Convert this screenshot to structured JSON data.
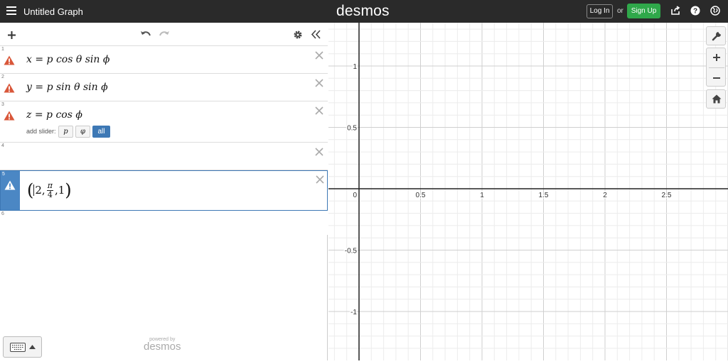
{
  "header": {
    "title": "Untitled Graph",
    "logo": "desmos",
    "login_label": "Log In",
    "or_text": "or",
    "signup_label": "Sign Up"
  },
  "toolbar": {
    "add_icon": "plus-icon",
    "undo_icon": "undo-icon",
    "redo_icon": "redo-icon",
    "settings_icon": "gear-icon",
    "collapse_icon": "double-chevron-left-icon"
  },
  "expressions": [
    {
      "number": "1",
      "var": "x",
      "rhs": "p cos θ sin ϕ",
      "warning": true
    },
    {
      "number": "2",
      "var": "y",
      "rhs": "p sin θ sin ϕ",
      "warning": true
    },
    {
      "number": "3",
      "var": "z",
      "rhs": "p cos ϕ",
      "warning": true,
      "slider": {
        "label": "add slider:",
        "options": [
          "p",
          "φ",
          "all"
        ]
      }
    },
    {
      "number": "4",
      "text": ""
    },
    {
      "number": "5",
      "point": {
        "a": "2",
        "b_num": "π",
        "b_den": "4",
        "c": "1"
      },
      "warning": true,
      "selected": true
    },
    {
      "number": "6",
      "text": ""
    }
  ],
  "footer": {
    "powered_by": "powered by",
    "brand": "desmos"
  },
  "graph": {
    "x_ticks": [
      "0",
      "0.5",
      "1",
      "1.5",
      "2",
      "2.5"
    ],
    "y_ticks": [
      "1",
      "0.5",
      "-0.5",
      "-1"
    ]
  },
  "colors": {
    "topbar": "#2a2a2a",
    "signup": "#2fa84a",
    "selected": "#4b87c4",
    "warning": "#d9573a"
  }
}
